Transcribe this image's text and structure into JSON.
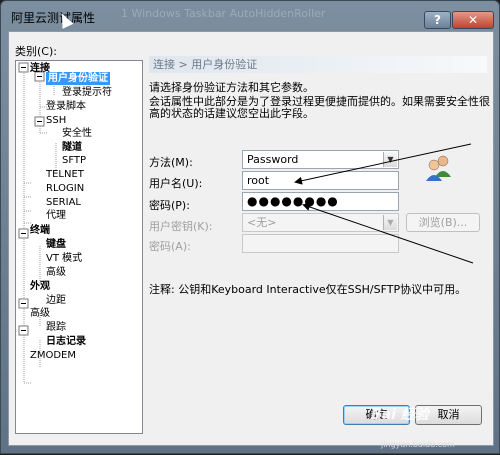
{
  "window": {
    "title": "阿里云测试属性",
    "title_faded": "1 Windows Taskbar AutoHiddenRoller",
    "help_label": "?",
    "close_label": "✕"
  },
  "category_label": "类别(C):",
  "tree": [
    {
      "label": "连接",
      "bold": true
    },
    {
      "label": "用户身份验证",
      "bold": true,
      "selected": true
    },
    {
      "label": "登录提示符"
    },
    {
      "label": "登录脚本"
    },
    {
      "label": "SSH"
    },
    {
      "label": "安全性"
    },
    {
      "label": "隧道",
      "bold": true
    },
    {
      "label": "SFTP"
    },
    {
      "label": "TELNET"
    },
    {
      "label": "RLOGIN"
    },
    {
      "label": "SERIAL"
    },
    {
      "label": "代理"
    },
    {
      "label": "终端",
      "bold": true
    },
    {
      "label": "键盘",
      "bold": true
    },
    {
      "label": "VT 模式"
    },
    {
      "label": "高级"
    },
    {
      "label": "外观",
      "bold": true
    },
    {
      "label": "边距"
    },
    {
      "label": "高级"
    },
    {
      "label": "跟踪"
    },
    {
      "label": "日志记录",
      "bold": true
    },
    {
      "label": "ZMODEM"
    }
  ],
  "panel": {
    "header": "连接 > 用户身份验证",
    "desc1": "请选择身份验证方法和其它参数。",
    "desc2": "会话属性中此部分是为了登录过程更便捷而提供的。如果需要安全性很高的状态的话建议您空出此字段。"
  },
  "form": {
    "method_label": "方法(M):",
    "method_value": "Password",
    "username_label": "用户名(U):",
    "username_value": "root",
    "password_label": "密码(P):",
    "password_value": "●●●●●●●●",
    "key_label": "用户密钥(K):",
    "key_value": "<无>",
    "passphrase_label": "密码(A):",
    "passphrase_value": "",
    "browse_label": "浏览(B)..."
  },
  "note": "注释: 公钥和Keyboard Interactive仅在SSH/SFTP协议中可用。",
  "buttons": {
    "ok": "确定",
    "cancel": "取消"
  },
  "watermark": {
    "brand": "Bai 经验",
    "url": "jingyan.baidu.com"
  },
  "colors": {
    "selection": "#3399ff",
    "title_bar": "#6b7f93",
    "panel_header_text": "#6b7a8a"
  }
}
